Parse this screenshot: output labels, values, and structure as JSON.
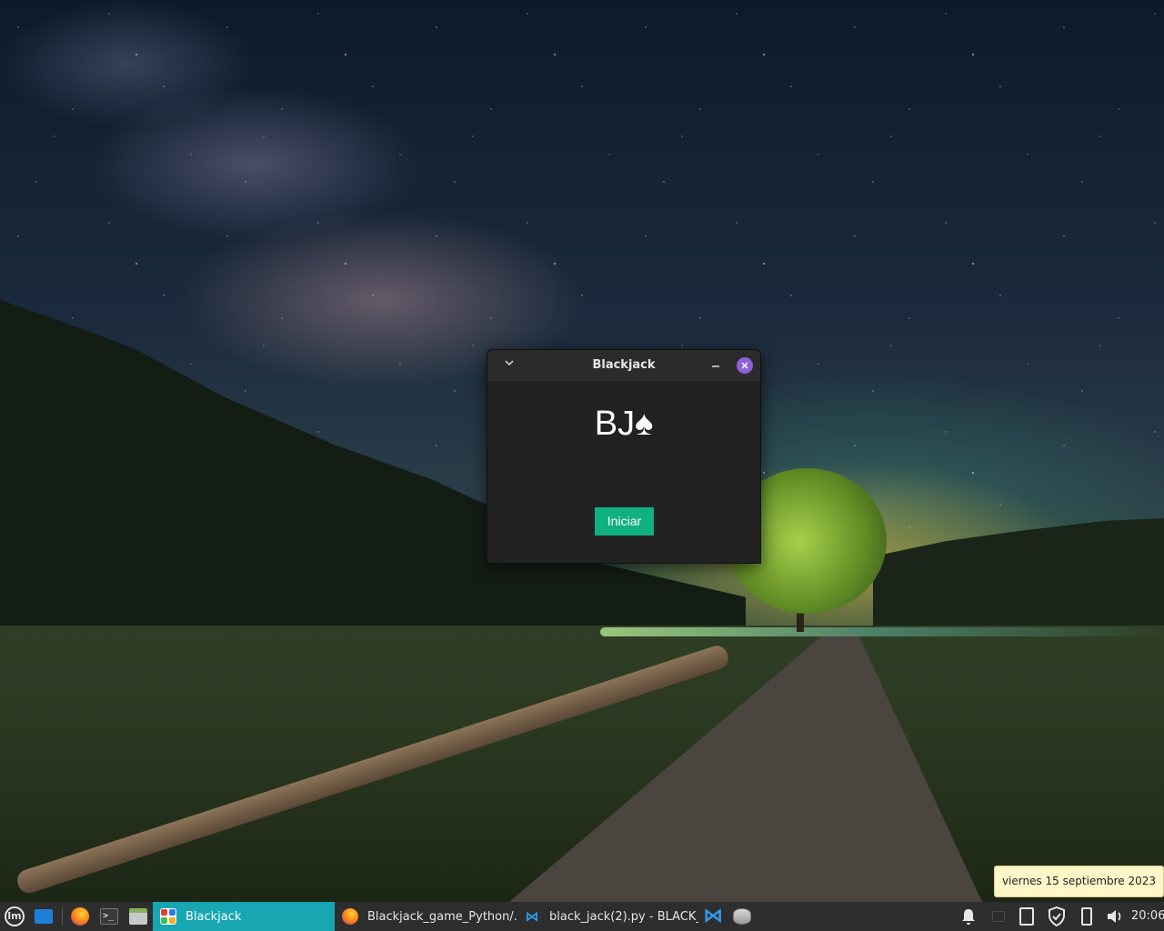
{
  "window": {
    "title": "Blackjack",
    "menu_icon": "chevron-down-icon",
    "minimize_icon": "minimize-icon",
    "close_icon": "close-icon",
    "logo_text": "BJ♠",
    "start_button_label": "Iniciar",
    "accent_color": "#10b07f",
    "close_color": "#8f5fd6"
  },
  "tooltip": {
    "text": "viernes 15 septiembre 2023",
    "background": "#fff7c8"
  },
  "taskbar": {
    "launchers": [
      {
        "name": "menu",
        "icon": "linux-mint-menu-icon"
      },
      {
        "name": "show-desktop",
        "icon": "show-desktop-icon"
      },
      {
        "name": "firefox",
        "icon": "firefox-icon"
      },
      {
        "name": "terminal",
        "icon": "terminal-icon"
      },
      {
        "name": "files",
        "icon": "files-icon"
      }
    ],
    "tasks": [
      {
        "label": "Blackjack",
        "icon": "blackjack-app-icon",
        "active": true
      },
      {
        "label": "Blackjack_game_Python/...",
        "icon": "firefox-icon",
        "active": false
      },
      {
        "label": "black_jack(2).py - BLACK_...",
        "icon": "vscode-icon",
        "active": false
      }
    ],
    "pinned_after": [
      {
        "name": "vscode",
        "icon": "vscode-icon"
      },
      {
        "name": "disks",
        "icon": "disks-icon"
      }
    ],
    "tray": [
      {
        "name": "notifications",
        "icon": "bell-icon"
      },
      {
        "name": "placeholder",
        "icon": "window-icon"
      },
      {
        "name": "clipboard",
        "icon": "clipboard-icon"
      },
      {
        "name": "update-manager",
        "icon": "shield-icon"
      },
      {
        "name": "power",
        "icon": "battery-icon"
      },
      {
        "name": "sound",
        "icon": "volume-icon"
      }
    ],
    "clock": "20:06",
    "active_color": "#17a6b2"
  }
}
